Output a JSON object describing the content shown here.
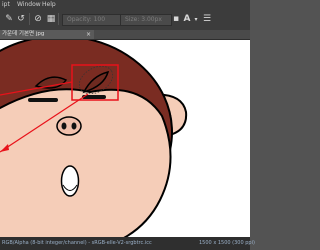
{
  "menubar": {
    "items": [
      "ipt",
      "Window",
      "Help"
    ]
  },
  "toolbar": {
    "opacity_label": "Opacity: 100",
    "size_label": "Size: 3.00px",
    "dropdown_label": "A",
    "icons": [
      "brush-tool-icon",
      "reset-icon",
      "layer-icon",
      "pattern-icon",
      "color-icon",
      "text-icon",
      "settings-icon"
    ]
  },
  "document": {
    "tab_title": "가운데 기본면 jpg",
    "close_symbol": "×"
  },
  "status": {
    "left": "RGB/Alpha (8-bit integer/channel) - sRGB-elle-V2-srgbtrc.icc",
    "right": "1500 x 1500 (300 ppi)"
  },
  "colors": {
    "ui_dark": "#3c3c3c",
    "face_skin": "#f5cdb8",
    "hair_brown": "#7a2c22",
    "red_annotation": "#e8121a"
  }
}
